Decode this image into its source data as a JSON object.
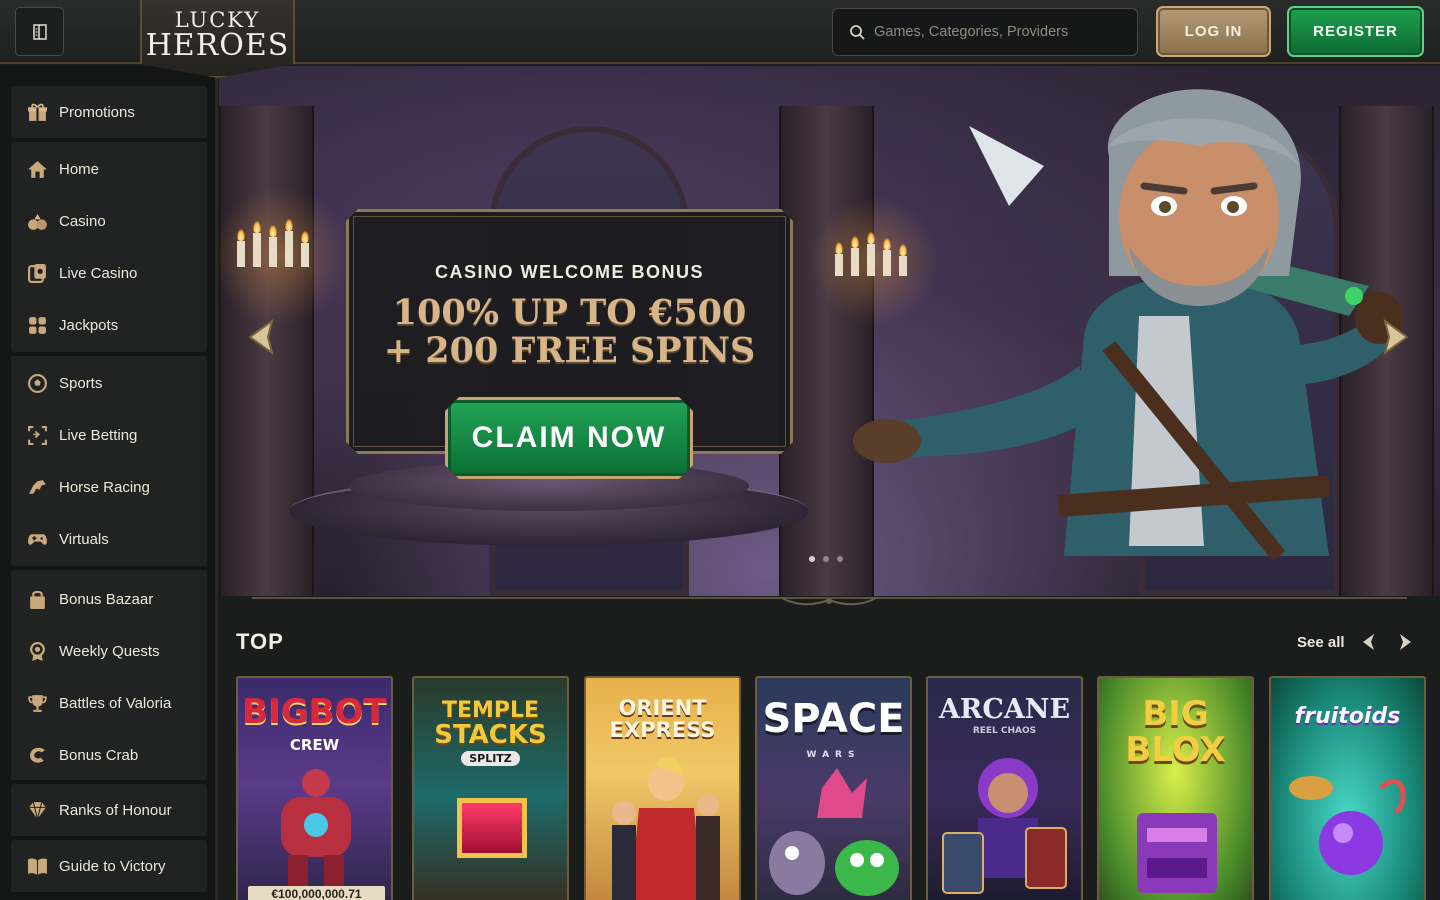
{
  "header": {
    "logo_line1": "LUCKY",
    "logo_line2": "HEROES",
    "search_placeholder": "Games, Categories, Providers",
    "login_label": "LOG IN",
    "register_label": "REGISTER"
  },
  "sidebar": {
    "items": [
      {
        "label": "Promotions",
        "icon": "gift-icon"
      },
      {
        "label": "Home",
        "icon": "home-icon"
      },
      {
        "label": "Casino",
        "icon": "cards-icon"
      },
      {
        "label": "Live Casino",
        "icon": "live-casino-icon"
      },
      {
        "label": "Jackpots",
        "icon": "jackpot-icon"
      },
      {
        "label": "Sports",
        "icon": "soccer-ball-icon"
      },
      {
        "label": "Live Betting",
        "icon": "live-betting-icon"
      },
      {
        "label": "Horse Racing",
        "icon": "horse-icon"
      },
      {
        "label": "Virtuals",
        "icon": "gamepad-icon"
      },
      {
        "label": "Bonus Bazaar",
        "icon": "shopping-bag-icon"
      },
      {
        "label": "Weekly Quests",
        "icon": "badge-icon"
      },
      {
        "label": "Battles of Valoria",
        "icon": "trophy-icon"
      },
      {
        "label": "Bonus Crab",
        "icon": "crab-icon"
      },
      {
        "label": "Ranks of Honour",
        "icon": "diamond-icon"
      },
      {
        "label": "Guide to Victory",
        "icon": "book-icon"
      }
    ]
  },
  "banner": {
    "eyebrow": "CASINO WELCOME BONUS",
    "title_line1": "100% UP TO €500",
    "title_line2": "+ 200 FREE SPINS",
    "cta_label": "CLAIM NOW",
    "slide_count": 3,
    "active_slide": 1
  },
  "top_section": {
    "title": "TOP",
    "see_all_label": "See all",
    "games": [
      {
        "title": "BIGBOT",
        "subtitle": "CREW",
        "jackpot": "€100,000,000.71"
      },
      {
        "title": "TEMPLE",
        "subtitle": "STACKS",
        "tag": "SPLITZ"
      },
      {
        "title": "ORIENT",
        "subtitle": "EXPRESS"
      },
      {
        "title": "SPACE",
        "subtitle": "WARS"
      },
      {
        "title": "ARCANE",
        "subtitle": "REEL CHAOS"
      },
      {
        "title": "BIG",
        "subtitle": "BLOX"
      },
      {
        "title": "fruitoids"
      }
    ]
  },
  "colors": {
    "accent_gold": "#d8b589",
    "cta_green": "#1a9a4e",
    "background": "#1a1d1c",
    "sidebar_panel": "#202322"
  }
}
